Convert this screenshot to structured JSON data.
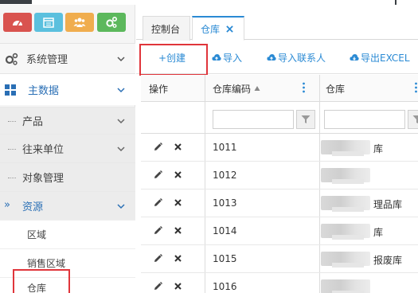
{
  "sidebar": {
    "shortcut_icons": [
      "dashboard-icon",
      "calendar-icon",
      "users-icon",
      "cogs-icon"
    ],
    "system_management": "系统管理",
    "master_data": "主数据",
    "product": "产品",
    "partners": "往来单位",
    "object_management": "对象管理",
    "resources": "资源",
    "raquo": "»",
    "area": "区域",
    "sales_area": "销售区域",
    "warehouse": "仓库"
  },
  "tabs": {
    "console": "控制台",
    "warehouse": "仓库"
  },
  "toolbar": {
    "create": "+创建",
    "import": "导入",
    "import_contacts": "导入联系人",
    "export": "导出EXCEL"
  },
  "grid": {
    "columns": [
      "操作",
      "仓库编码",
      "仓库"
    ],
    "rows": [
      {
        "code": "1011",
        "name_tail": "库"
      },
      {
        "code": "1012",
        "name_tail": ""
      },
      {
        "code": "1013",
        "name_tail": "理品库"
      },
      {
        "code": "1014",
        "name_tail": "库"
      },
      {
        "code": "1015",
        "name_tail": "报废库"
      },
      {
        "code": "1016",
        "name_tail": ""
      }
    ]
  },
  "colors": {
    "accent": "#2a8ad4",
    "highlight": "#e0353b",
    "sc_red": "#d9534f",
    "sc_blue": "#5bc0de",
    "sc_orange": "#f0ad4e",
    "sc_green": "#5cb85c"
  }
}
